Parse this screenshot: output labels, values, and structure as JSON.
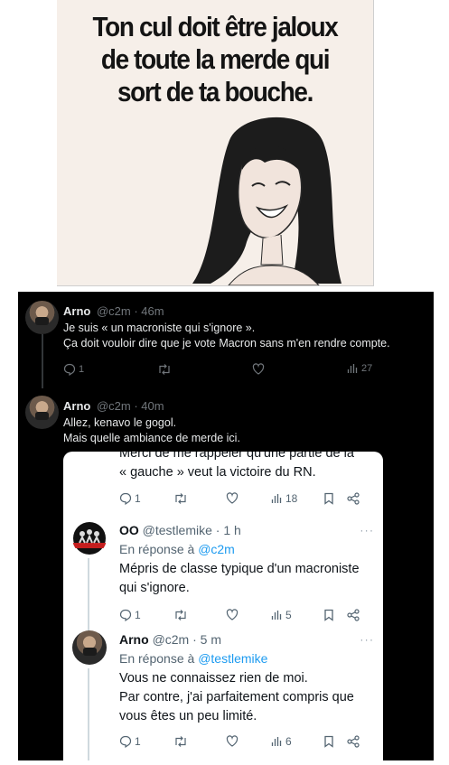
{
  "meme": {
    "line1": "Ton cul doit être jaloux",
    "line2": "de toute la merde qui",
    "line3": "sort de ta bouche."
  },
  "tweets": [
    {
      "name": "Arno",
      "handle": "@c2m · 46m",
      "lines": [
        "Je suis « un macroniste qui s'ignore ».",
        "Ça doit vouloir dire que je vote Macron sans m'en rendre compte."
      ],
      "reply_count": "1",
      "views": "27"
    },
    {
      "name": "Arno",
      "handle": "@c2m · 40m",
      "lines": [
        "Allez, kenavo le gogol.",
        "Mais quelle ambiance de merde ici."
      ]
    }
  ],
  "embedded": {
    "top_lines": [
      "Merci de me rappeler qu'une partie de la",
      "« gauche » veut la victoire du RN."
    ],
    "top_actions": {
      "replies": "1",
      "views": "18"
    },
    "reply1": {
      "name": "OO",
      "handle": "@testlemike · 1 h",
      "reply_prefix": "En réponse à",
      "reply_to": "@c2m",
      "lines": [
        "Mépris de classe typique d'un macroniste",
        "qui s'ignore."
      ],
      "replies": "1",
      "views": "5"
    },
    "reply2": {
      "name": "Arno",
      "handle": "@c2m · 5 m",
      "reply_prefix": "En réponse à",
      "reply_to": "@testlemike",
      "lines": [
        "Vous ne connaissez rien de moi.",
        "Par contre, j'ai parfaitement compris que",
        "vous êtes un peu limité."
      ],
      "replies": "1",
      "views": "6"
    }
  }
}
